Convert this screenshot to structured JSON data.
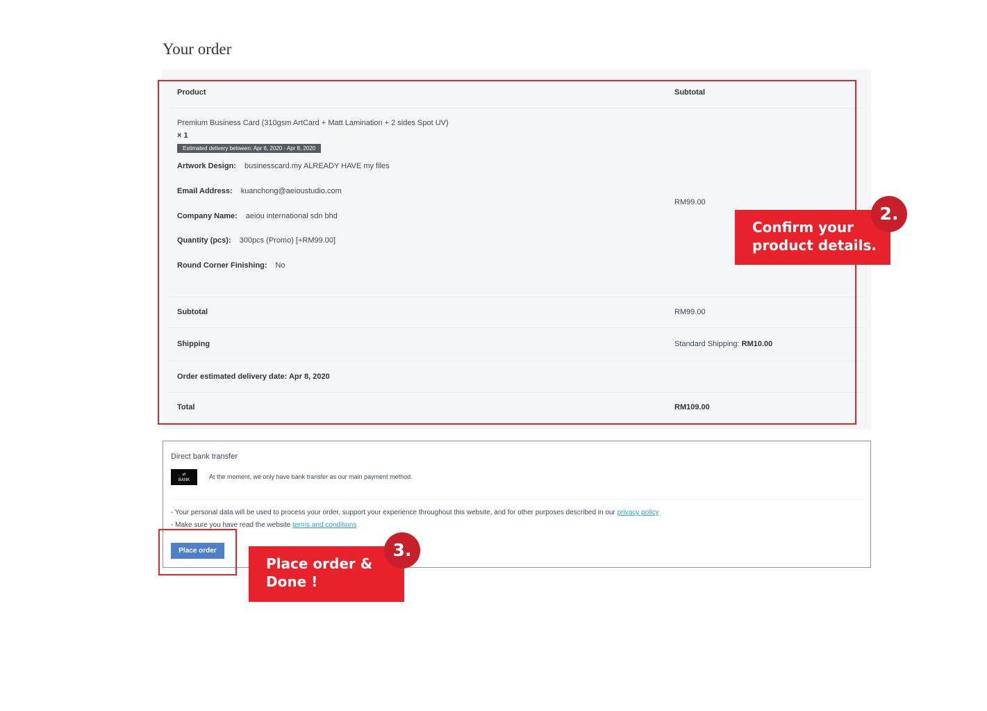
{
  "page": {
    "title": "Your order"
  },
  "order": {
    "header": {
      "product": "Product",
      "subtotal": "Subtotal"
    },
    "item": {
      "name": "Premium Business Card (310gsm ArtCard + Matt Lamination + 2 sides Spot UV)",
      "qty": "× 1",
      "delivery_badge": "Estimated delivery between: Apr 6, 2020 - Apr 8, 2020",
      "meta": [
        {
          "key": "Artwork Design:",
          "value": "businesscard.my ALREADY HAVE my files"
        },
        {
          "key": "Email Address:",
          "value": "kuanchong@aeioustudio.com"
        },
        {
          "key": "Company Name:",
          "value": "aeiou international sdn bhd"
        },
        {
          "key": "Quantity (pcs):",
          "value": "300pcs (Promo) [+RM99.00]"
        },
        {
          "key": "Round Corner Finishing:",
          "value": "No"
        }
      ],
      "price": "RM99.00"
    },
    "subtotal": {
      "label": "Subtotal",
      "value": "RM99.00"
    },
    "shipping": {
      "label": "Shipping",
      "method": "Standard Shipping:",
      "amount": "RM10.00"
    },
    "delivery_date": {
      "label": "Order estimated delivery date: Apr 8, 2020"
    },
    "total": {
      "label": "Total",
      "value": "RM109.00"
    }
  },
  "payment": {
    "method_title": "Direct bank transfer",
    "logo_text": "BANK",
    "description": "At the moment, we only have bank transfer as our main payment method.",
    "privacy_text": "- Your personal data will be used to process your order, support your experience throughout this website, and for other purposes described in our ",
    "privacy_link": "privacy policy",
    "terms_text": "- Make sure you have read the website ",
    "terms_link": "terms and conditions",
    "place_order": "Place order"
  },
  "callouts": {
    "confirm": {
      "number": "2.",
      "line1": "Confirm your",
      "line2": "product details."
    },
    "place": {
      "number": "3.",
      "line1": "Place order &",
      "line2": "Done !"
    }
  },
  "colors": {
    "callout_red": "#e8222a",
    "circle_red": "#c8202b",
    "button_blue": "#4f80c4",
    "link_blue": "#2b9ed8"
  }
}
